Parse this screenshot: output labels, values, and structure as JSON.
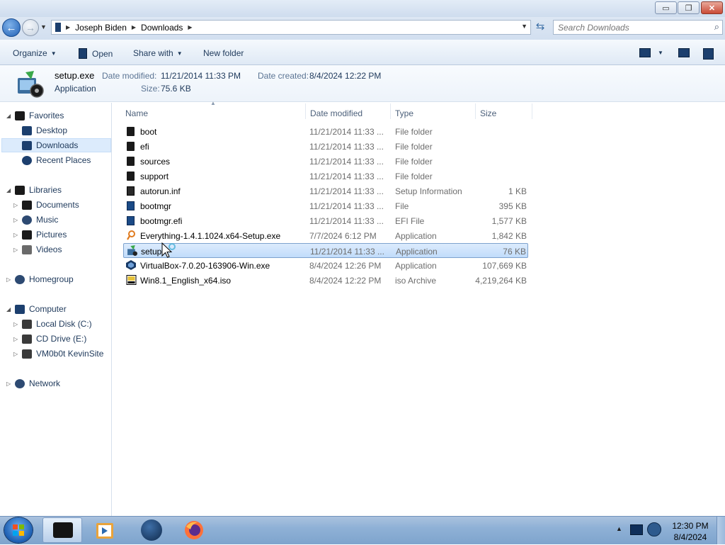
{
  "window": {
    "controls": {
      "minimize": "▭",
      "maximize": "❐",
      "close": "✕"
    }
  },
  "address": {
    "breadcrumbs": [
      "Joseph Biden",
      "Downloads"
    ],
    "search_placeholder": "Search Downloads"
  },
  "toolbar": {
    "organize": "Organize",
    "open": "Open",
    "share_with": "Share with",
    "new_folder": "New folder"
  },
  "details": {
    "name": "setup.exe",
    "type": "Application",
    "date_modified_label": "Date modified:",
    "date_modified": "11/21/2014 11:33 PM",
    "date_created_label": "Date created:",
    "date_created": "8/4/2024 12:22 PM",
    "size_label": "Size:",
    "size": "75.6 KB"
  },
  "nav": {
    "favorites": "Favorites",
    "desktop": "Desktop",
    "downloads": "Downloads",
    "recent_places": "Recent Places",
    "libraries": "Libraries",
    "documents": "Documents",
    "music": "Music",
    "pictures": "Pictures",
    "videos": "Videos",
    "homegroup": "Homegroup",
    "computer": "Computer",
    "local_disk": "Local Disk (C:)",
    "cd_drive": "CD Drive (E:)",
    "vm_share": "VM0b0t KevinSite",
    "network": "Network"
  },
  "columns": {
    "name": "Name",
    "date_modified": "Date modified",
    "type": "Type",
    "size": "Size"
  },
  "files": [
    {
      "name": "boot",
      "date": "11/21/2014 11:33 ...",
      "type": "File folder",
      "size": ""
    },
    {
      "name": "efi",
      "date": "11/21/2014 11:33 ...",
      "type": "File folder",
      "size": ""
    },
    {
      "name": "sources",
      "date": "11/21/2014 11:33 ...",
      "type": "File folder",
      "size": ""
    },
    {
      "name": "support",
      "date": "11/21/2014 11:33 ...",
      "type": "File folder",
      "size": ""
    },
    {
      "name": "autorun.inf",
      "date": "11/21/2014 11:33 ...",
      "type": "Setup Information",
      "size": "1 KB"
    },
    {
      "name": "bootmgr",
      "date": "11/21/2014 11:33 ...",
      "type": "File",
      "size": "395 KB"
    },
    {
      "name": "bootmgr.efi",
      "date": "11/21/2014 11:33 ...",
      "type": "EFI File",
      "size": "1,577 KB"
    },
    {
      "name": "Everything-1.4.1.1024.x64-Setup.exe",
      "date": "7/7/2024 6:12 PM",
      "type": "Application",
      "size": "1,842 KB"
    },
    {
      "name": "setup",
      "date": "11/21/2014 11:33 ...",
      "type": "Application",
      "size": "76 KB"
    },
    {
      "name": "VirtualBox-7.0.20-163906-Win.exe",
      "date": "8/4/2024 12:26 PM",
      "type": "Application",
      "size": "107,669 KB"
    },
    {
      "name": "Win8.1_English_x64.iso",
      "date": "8/4/2024 12:22 PM",
      "type": "iso Archive",
      "size": "4,219,264 KB"
    }
  ],
  "taskbar": {
    "time": "12:30 PM",
    "date": "8/4/2024"
  },
  "colors": {
    "selection": "#c1dcfb",
    "taskbar": "#8fb1d6",
    "text": "#1e395b"
  }
}
